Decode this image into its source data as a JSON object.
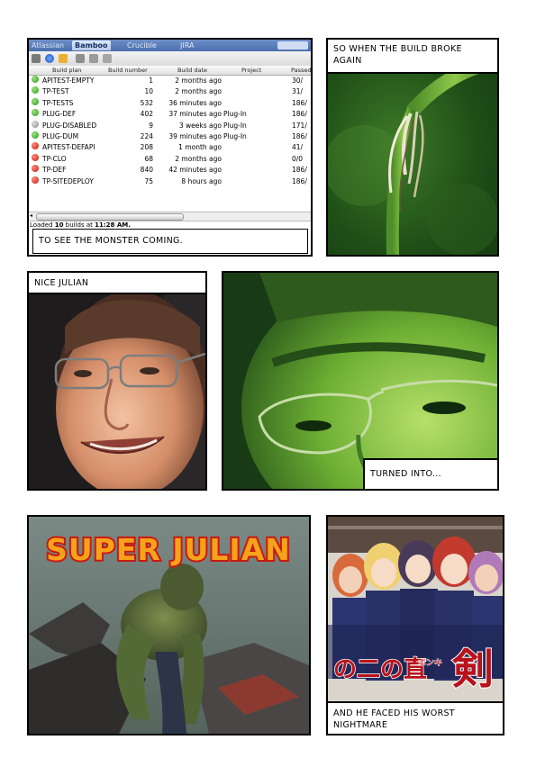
{
  "bamboo": {
    "tabs": [
      "Atlassian",
      "Bamboo",
      "Crucible",
      "JIRA"
    ],
    "columns": [
      "Build plan",
      "Build number",
      "Build date",
      "Project",
      "Passed"
    ],
    "rows": [
      {
        "status": "ok",
        "plan": "APITEST-EMPTY",
        "number": "1",
        "date": "2 months ago",
        "project": "",
        "passed": "30/"
      },
      {
        "status": "ok",
        "plan": "TP-TEST",
        "number": "10",
        "date": "2 months ago",
        "project": "",
        "passed": "31/"
      },
      {
        "status": "ok",
        "plan": "TP-TESTS",
        "number": "532",
        "date": "36 minutes ago",
        "project": "",
        "passed": "186/"
      },
      {
        "status": "ok",
        "plan": "PLUG-DEF",
        "number": "402",
        "date": "37 minutes ago",
        "project": "Plug-In",
        "passed": "186/"
      },
      {
        "status": "dis",
        "plan": "PLUG-DISABLED",
        "number": "9",
        "date": "3 weeks ago",
        "project": "Plug-In",
        "passed": "171/"
      },
      {
        "status": "ok",
        "plan": "PLUG-DUM",
        "number": "224",
        "date": "39 minutes ago",
        "project": "Plug-In",
        "passed": "186/"
      },
      {
        "status": "fail",
        "plan": "APITEST-DEFAPI",
        "number": "208",
        "date": "1 month ago",
        "project": "",
        "passed": "41/"
      },
      {
        "status": "fail",
        "plan": "TP-CLO",
        "number": "68",
        "date": "2 months ago",
        "project": "",
        "passed": "0/0"
      },
      {
        "status": "fail",
        "plan": "TP-DEF",
        "number": "840",
        "date": "42 minutes ago",
        "project": "",
        "passed": "186/"
      },
      {
        "status": "fail",
        "plan": "TP-SITEDEPLOY",
        "number": "75",
        "date": "8 hours ago",
        "project": "",
        "passed": "186/"
      }
    ],
    "status_prefix": "Loaded ",
    "status_count": "10",
    "status_mid": " builds at ",
    "status_time": "11:28 AM."
  },
  "captions": {
    "p1": "TO SEE THE MONSTER COMING.",
    "p2": "SO WHEN THE BUILD BROKE AGAIN",
    "p3": "NICE JULIAN",
    "p4": "TURNED INTO...",
    "p5_title": "SUPER JULIAN",
    "p6": "AND HE FACED HIS WORST NIGHTMARE"
  },
  "poster_text": {
    "left": "の二の直",
    "right": "剣",
    "small": "ボンキ"
  },
  "colors": {
    "border": "#000000",
    "title_fill": "#f6a21b",
    "title_stroke": "#c81a10",
    "tab_active": "#4a6fae"
  }
}
